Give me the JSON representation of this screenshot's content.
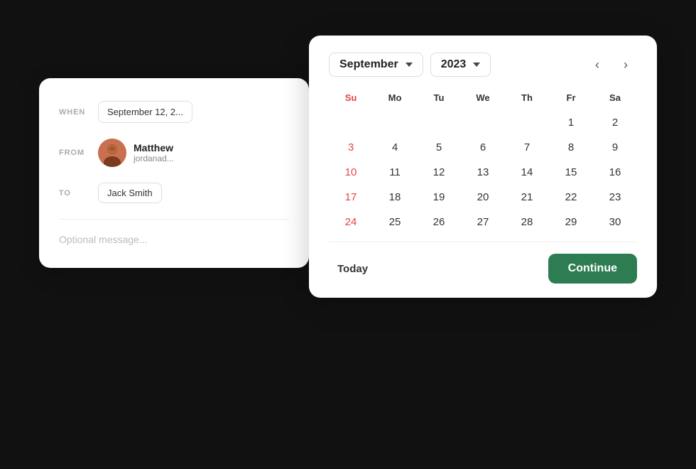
{
  "form": {
    "when_label": "WHEN",
    "when_value": "September 12, 2...",
    "from_label": "FROM",
    "from_name": "Matthew",
    "from_email": "jordanad...",
    "to_label": "TO",
    "to_value": "Jack Smith",
    "message_placeholder": "Optional message..."
  },
  "calendar": {
    "month": "September",
    "year": "2023",
    "nav_prev": "‹",
    "nav_next": "›",
    "day_headers": [
      "Su",
      "Mo",
      "Tu",
      "We",
      "Th",
      "Fr",
      "Sa"
    ],
    "weeks": [
      [
        "",
        "",
        "",
        "",
        "",
        "1",
        "2"
      ],
      [
        "3",
        "4",
        "5",
        "6",
        "7",
        "8",
        "9"
      ],
      [
        "10",
        "11",
        "12",
        "13",
        "14",
        "15",
        "16"
      ],
      [
        "17",
        "18",
        "19",
        "20",
        "21",
        "22",
        "23"
      ],
      [
        "24",
        "25",
        "26",
        "27",
        "28",
        "29",
        "30"
      ]
    ],
    "today_label": "Today",
    "continue_label": "Continue"
  }
}
